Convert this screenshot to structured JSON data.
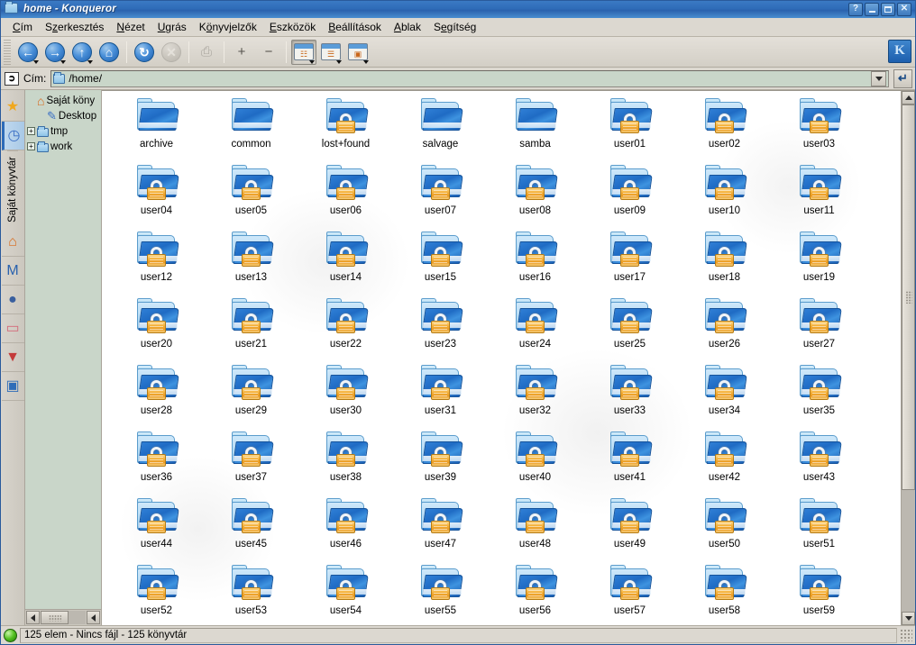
{
  "window": {
    "title": "home - Konqueror",
    "title_icon": "folder-icon",
    "buttons": {
      "help": "?",
      "minimize": "minimize-icon",
      "maximize": "maximize-icon",
      "close": "✕"
    }
  },
  "menubar": {
    "items": [
      {
        "label": "Cím",
        "accel_index": 0
      },
      {
        "label": "Szerkesztés",
        "accel_index": 1
      },
      {
        "label": "Nézet",
        "accel_index": 0
      },
      {
        "label": "Ugrás",
        "accel_index": 0
      },
      {
        "label": "Könyvjelzők",
        "accel_index": 1
      },
      {
        "label": "Eszközök",
        "accel_index": 0
      },
      {
        "label": "Beállítások",
        "accel_index": 0
      },
      {
        "label": "Ablak",
        "accel_index": 0
      },
      {
        "label": "Segítség",
        "accel_index": 1
      }
    ]
  },
  "toolbar": {
    "buttons": [
      {
        "name": "back-button",
        "glyph": "←",
        "enabled": true,
        "has_menu": true,
        "active": false
      },
      {
        "name": "forward-button",
        "glyph": "→",
        "enabled": true,
        "has_menu": true,
        "active": false
      },
      {
        "name": "up-button",
        "glyph": "↑",
        "enabled": true,
        "has_menu": true,
        "active": false
      },
      {
        "name": "home-button",
        "glyph": "⌂",
        "enabled": true,
        "has_menu": false,
        "active": false
      },
      {
        "name": "reload-button",
        "glyph": "↻",
        "enabled": true,
        "has_menu": false,
        "active": false
      },
      {
        "name": "stop-button",
        "glyph": "✕",
        "enabled": false,
        "has_menu": false,
        "active": false
      },
      {
        "name": "print-button",
        "glyph": "⎙",
        "enabled": false,
        "has_menu": false,
        "active": false
      },
      {
        "name": "zoom-in-button",
        "glyph": "+",
        "enabled": true,
        "has_menu": false,
        "active": false
      },
      {
        "name": "zoom-out-button",
        "glyph": "−",
        "enabled": true,
        "has_menu": false,
        "active": false
      },
      {
        "name": "icon-view-button",
        "glyph": "☷",
        "enabled": true,
        "has_menu": true,
        "active": true
      },
      {
        "name": "list-view-button",
        "glyph": "☰",
        "enabled": true,
        "has_menu": true,
        "active": false
      },
      {
        "name": "preview-view-button",
        "glyph": "▣",
        "enabled": true,
        "has_menu": true,
        "active": false
      }
    ],
    "kde_logo": "K"
  },
  "location": {
    "clear_icon": "clear-location-icon",
    "label": "Cím:",
    "value": "/home/",
    "folder_icon": "folder-icon",
    "dropdown_icon": "chevron-down-icon",
    "go_icon": "↵"
  },
  "sidebar": {
    "vertical_tab": "Saját könyvtár",
    "icons": [
      {
        "name": "bookmarks-icon",
        "glyph": "★",
        "color": "#f0a81e",
        "selected": false
      },
      {
        "name": "history-icon",
        "glyph": "◷",
        "color": "#3a6fc4",
        "selected": true
      },
      {
        "name": "home-icon",
        "glyph": "⌂",
        "color": "#d8691a",
        "selected": false
      },
      {
        "name": "media-icon",
        "glyph": "M",
        "color": "#2a62ae",
        "selected": false
      },
      {
        "name": "network-icon",
        "glyph": "●",
        "color": "#3a5f9e",
        "selected": false
      },
      {
        "name": "root-folder-icon",
        "glyph": "▭",
        "color": "#d46a7a",
        "selected": false
      },
      {
        "name": "services-icon",
        "glyph": "▼",
        "color": "#c43a3a",
        "selected": false
      },
      {
        "name": "devices-icon",
        "glyph": "▣",
        "color": "#2f6cb8",
        "selected": false
      }
    ]
  },
  "tree": {
    "nodes": [
      {
        "label": "Saját köny",
        "icon": "home-icon",
        "indent": 0,
        "expander": null,
        "truncated": true
      },
      {
        "label": "Desktop",
        "icon": "desktop-icon",
        "indent": 1,
        "expander": null,
        "truncated": false
      },
      {
        "label": "tmp",
        "icon": "folder-icon",
        "indent": 0,
        "expander": "+",
        "truncated": false
      },
      {
        "label": "work",
        "icon": "folder-icon",
        "indent": 0,
        "expander": "+",
        "truncated": false
      }
    ],
    "hscroll_left_icon": "caret-left-icon",
    "hscroll_right_icon": "caret-left-icon"
  },
  "iconview": {
    "items": [
      {
        "label": "archive",
        "locked": false
      },
      {
        "label": "common",
        "locked": false
      },
      {
        "label": "lost+found",
        "locked": true
      },
      {
        "label": "salvage",
        "locked": false
      },
      {
        "label": "samba",
        "locked": false
      },
      {
        "label": "user01",
        "locked": true
      },
      {
        "label": "user02",
        "locked": true
      },
      {
        "label": "user03",
        "locked": true
      },
      {
        "label": "user04",
        "locked": true
      },
      {
        "label": "user05",
        "locked": true
      },
      {
        "label": "user06",
        "locked": true
      },
      {
        "label": "user07",
        "locked": true
      },
      {
        "label": "user08",
        "locked": true
      },
      {
        "label": "user09",
        "locked": true
      },
      {
        "label": "user10",
        "locked": true
      },
      {
        "label": "user11",
        "locked": true
      },
      {
        "label": "user12",
        "locked": true
      },
      {
        "label": "user13",
        "locked": true
      },
      {
        "label": "user14",
        "locked": true
      },
      {
        "label": "user15",
        "locked": true
      },
      {
        "label": "user16",
        "locked": true
      },
      {
        "label": "user17",
        "locked": true
      },
      {
        "label": "user18",
        "locked": true
      },
      {
        "label": "user19",
        "locked": true
      },
      {
        "label": "user20",
        "locked": true
      },
      {
        "label": "user21",
        "locked": true
      },
      {
        "label": "user22",
        "locked": true
      },
      {
        "label": "user23",
        "locked": true
      },
      {
        "label": "user24",
        "locked": true
      },
      {
        "label": "user25",
        "locked": true
      },
      {
        "label": "user26",
        "locked": true
      },
      {
        "label": "user27",
        "locked": true
      },
      {
        "label": "user28",
        "locked": true
      },
      {
        "label": "user29",
        "locked": true
      },
      {
        "label": "user30",
        "locked": true
      },
      {
        "label": "user31",
        "locked": true
      },
      {
        "label": "user32",
        "locked": true
      },
      {
        "label": "user33",
        "locked": true
      },
      {
        "label": "user34",
        "locked": true
      },
      {
        "label": "user35",
        "locked": true
      },
      {
        "label": "user36",
        "locked": true
      },
      {
        "label": "user37",
        "locked": true
      },
      {
        "label": "user38",
        "locked": true
      },
      {
        "label": "user39",
        "locked": true
      },
      {
        "label": "user40",
        "locked": true
      },
      {
        "label": "user41",
        "locked": true
      },
      {
        "label": "user42",
        "locked": true
      },
      {
        "label": "user43",
        "locked": true
      },
      {
        "label": "user44",
        "locked": true
      },
      {
        "label": "user45",
        "locked": true
      },
      {
        "label": "user46",
        "locked": true
      },
      {
        "label": "user47",
        "locked": true
      },
      {
        "label": "user48",
        "locked": true
      },
      {
        "label": "user49",
        "locked": true
      },
      {
        "label": "user50",
        "locked": true
      },
      {
        "label": "user51",
        "locked": true
      },
      {
        "label": "user52",
        "locked": true
      },
      {
        "label": "user53",
        "locked": true
      },
      {
        "label": "user54",
        "locked": true
      },
      {
        "label": "user55",
        "locked": true
      },
      {
        "label": "user56",
        "locked": true
      },
      {
        "label": "user57",
        "locked": true
      },
      {
        "label": "user58",
        "locked": true
      },
      {
        "label": "user59",
        "locked": true
      }
    ],
    "scrollbar": {
      "up_icon": "caret-up-icon",
      "down_icon": "caret-down-icon"
    }
  },
  "statusbar": {
    "indicator": "green-led",
    "text": "125 elem - Nincs fájl - 125 könyvtár"
  }
}
